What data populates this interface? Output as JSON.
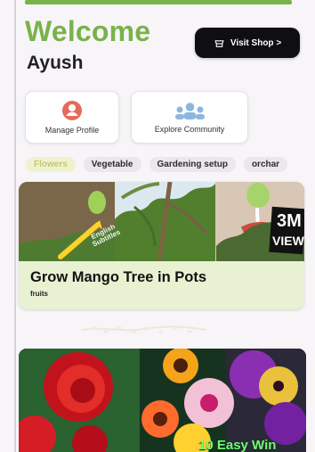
{
  "header": {
    "welcome": "Welcome",
    "user_name": "Ayush",
    "shop_label": "Visit Shop >"
  },
  "quick_actions": [
    {
      "label": "Manage Profile",
      "icon": "profile-icon"
    },
    {
      "label": "Explore Community",
      "icon": "community-icon"
    }
  ],
  "categories": [
    {
      "label": "Flowers",
      "selected": true
    },
    {
      "label": "Vegetable",
      "selected": false
    },
    {
      "label": "Gardening setup",
      "selected": false
    },
    {
      "label": "orchar",
      "selected": false
    }
  ],
  "feed": [
    {
      "title": "Grow Mango Tree in Pots",
      "subtitle": "fruits",
      "thumbnail": {
        "overlay_text_line_1": "English",
        "overlay_text_line_2": "Subtitles",
        "views_number": "3M",
        "views_label": "VIEW"
      }
    },
    {
      "caption": "10 Easy Win"
    }
  ],
  "colors": {
    "accent": "#7ab24a",
    "dark_button": "#0f0f12",
    "profile_icon": "#e46b5a",
    "community_icon": "#8db6df"
  }
}
